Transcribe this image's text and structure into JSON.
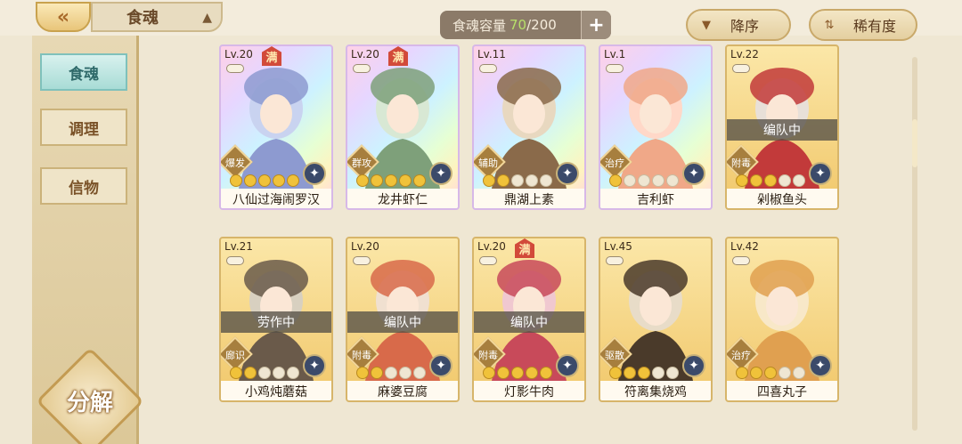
{
  "header": {
    "title": "食魂",
    "capacity_label": "食魂容量",
    "capacity_current": "70",
    "capacity_max": "/200",
    "sort_order": "降序",
    "sort_by": "稀有度"
  },
  "sidebar": {
    "items": [
      {
        "label": "食魂",
        "active": true
      },
      {
        "label": "调理",
        "active": false
      },
      {
        "label": "信物",
        "active": false
      }
    ],
    "decompose_label": "分解"
  },
  "cards": [
    {
      "lv": "Lv.20",
      "full": "满",
      "role": "爆发",
      "name": "八仙过海闹罗汉",
      "stars": 5,
      "status": "",
      "rainbow": true
    },
    {
      "lv": "Lv.20",
      "full": "满",
      "role": "群攻",
      "name": "龙井虾仁",
      "stars": 5,
      "status": "",
      "rainbow": true
    },
    {
      "lv": "Lv.11",
      "full": "",
      "role": "辅助",
      "name": "鼎湖上素",
      "stars": 2,
      "status": "",
      "rainbow": true
    },
    {
      "lv": "Lv.1",
      "full": "",
      "role": "治疗",
      "name": "吉利虾",
      "stars": 1,
      "status": "",
      "rainbow": true
    },
    {
      "lv": "Lv.22",
      "full": "",
      "role": "附毒",
      "name": "剁椒鱼头",
      "stars": 3,
      "status": "编队中",
      "rainbow": false
    },
    {
      "lv": "Lv.21",
      "full": "",
      "role": "廊识",
      "name": "小鸡炖蘑菇",
      "stars": 2,
      "status": "劳作中",
      "rainbow": false
    },
    {
      "lv": "Lv.20",
      "full": "",
      "role": "附毒",
      "name": "麻婆豆腐",
      "stars": 2,
      "status": "编队中",
      "rainbow": false
    },
    {
      "lv": "Lv.20",
      "full": "满",
      "role": "附毒",
      "name": "灯影牛肉",
      "stars": 5,
      "status": "编队中",
      "rainbow": false
    },
    {
      "lv": "Lv.45",
      "full": "",
      "role": "驱散",
      "name": "符离集烧鸡",
      "stars": 3,
      "status": "",
      "rainbow": false
    },
    {
      "lv": "Lv.42",
      "full": "",
      "role": "治疗",
      "name": "四喜丸子",
      "stars": 3,
      "status": "",
      "rainbow": false
    }
  ],
  "colors": {
    "accent_gold": "#d7b56a",
    "capacity_highlight": "#b7e06a",
    "active_tab": "#a8dcd6"
  }
}
